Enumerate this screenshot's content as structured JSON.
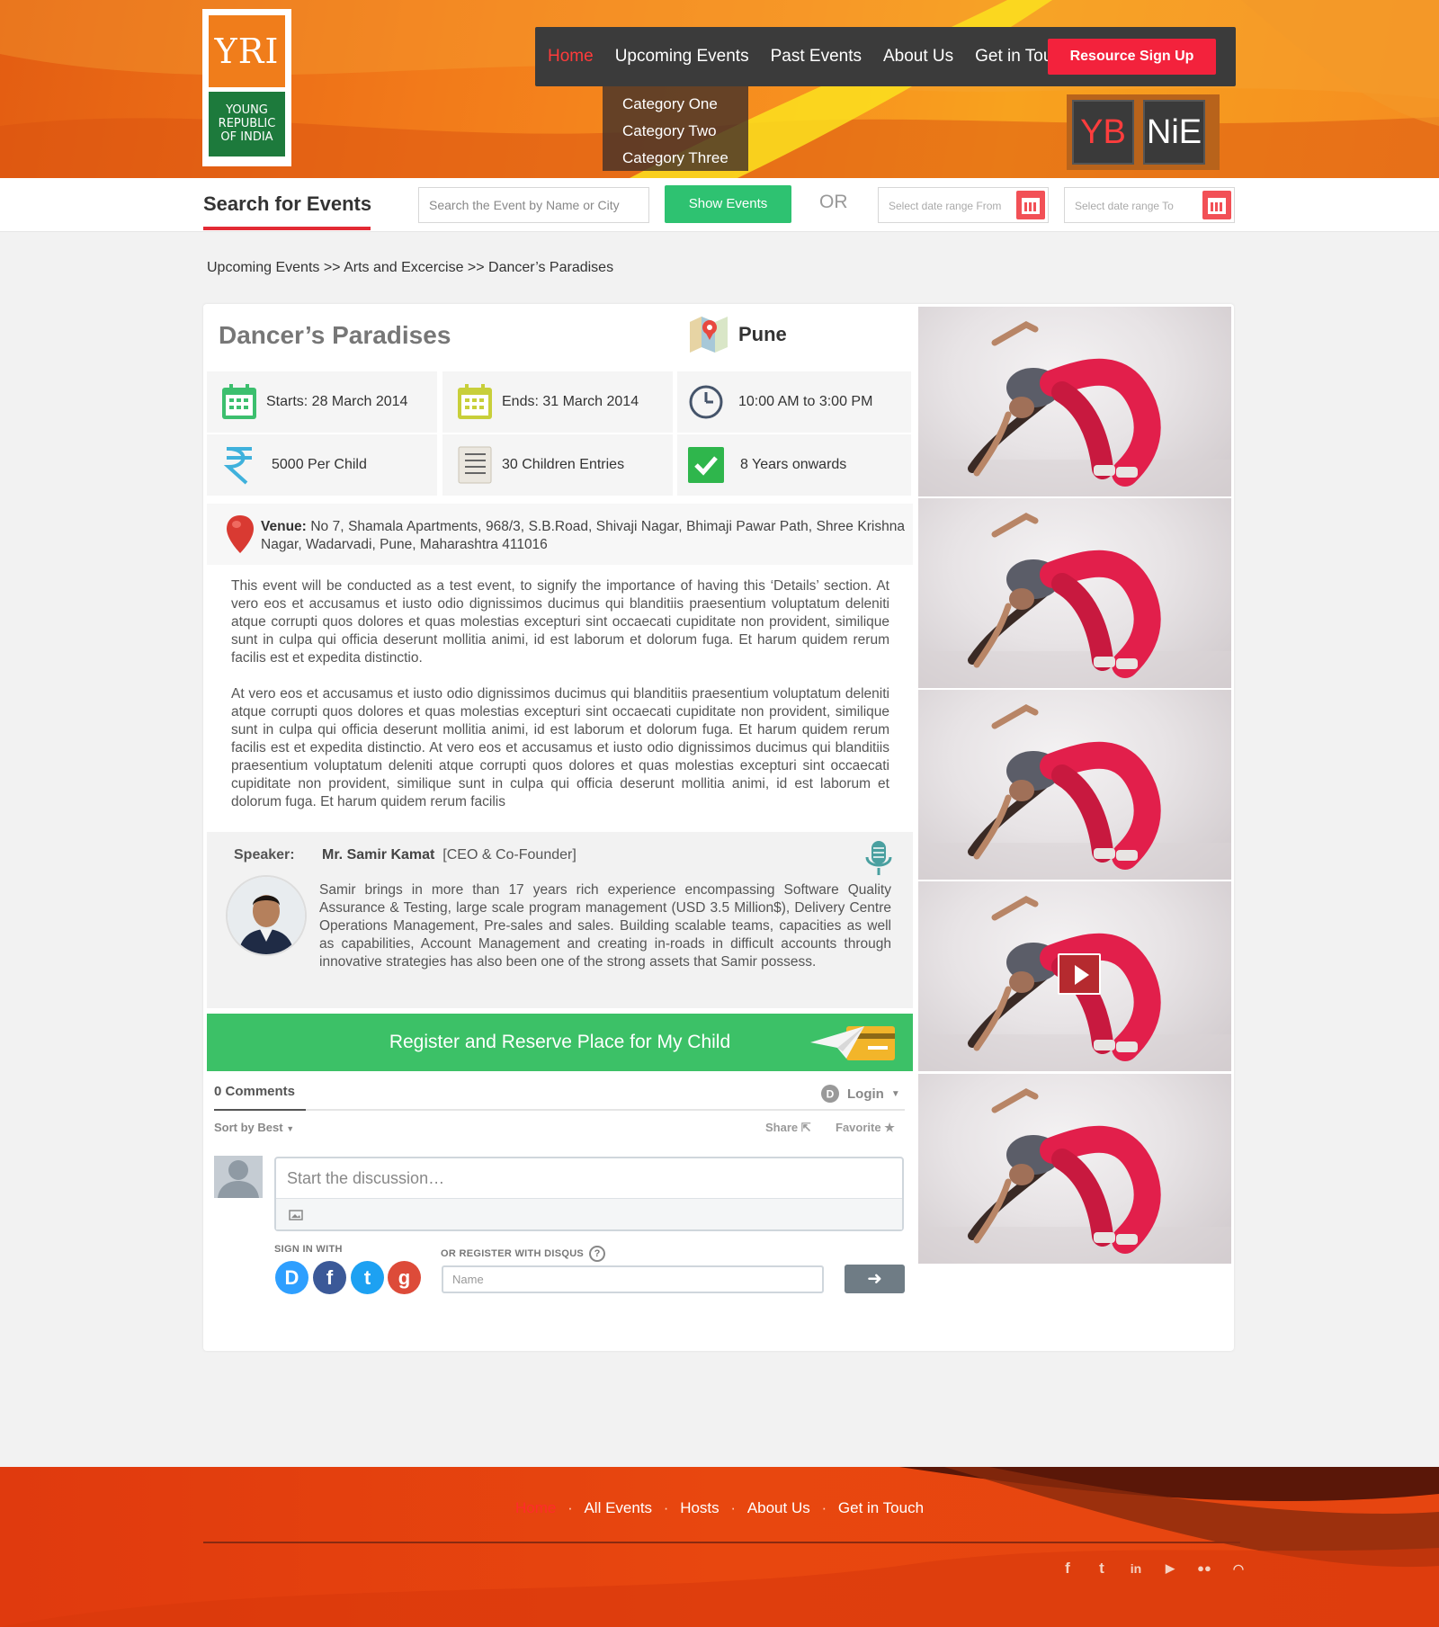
{
  "logo": {
    "mark": "YRI",
    "tagline_lines": [
      "YOUNG",
      "REPUBLIC",
      "OF INDIA"
    ]
  },
  "nav": {
    "items": [
      "Home",
      "Upcoming Events",
      "Past Events",
      "About Us",
      "Get in Touch"
    ],
    "active": "Home",
    "cta": "Resource Sign Up",
    "dropdown": [
      "Category One",
      "Category Two",
      "Category Three"
    ]
  },
  "partners": {
    "left": "YB",
    "right": "NiE"
  },
  "search": {
    "title": "Search for Events",
    "placeholder": "Search the Event by Name or City",
    "button": "Show Events",
    "or": "OR",
    "date_from": "Select date range From",
    "date_to": "Select date range To"
  },
  "breadcrumb": "Upcoming Events >> Arts and Excercise >> Dancer’s Paradises",
  "event": {
    "title": "Dancer’s Paradises",
    "city": "Pune",
    "starts": "Starts: 28 March 2014",
    "ends": "Ends: 31 March 2014",
    "time": "10:00 AM to 3:00 PM",
    "price": "5000 Per Child",
    "entries": "30 Children Entries",
    "age": "8 Years onwards",
    "venue_label": "Venue:",
    "venue": "No 7, Shamala Apartments, 968/3, S.B.Road, Shivaji Nagar, Bhimaji Pawar Path, Shree Krishna Nagar, Wadarvadi, Pune, Maharashtra 411016",
    "description_1": "This event will be conducted as a test event, to signify the importance of having this ‘Details’ section. At vero eos et accusamus et iusto odio dignissimos ducimus qui blanditiis praesentium voluptatum deleniti atque corrupti quos dolores et quas molestias excepturi sint occaecati cupiditate non provident, similique sunt in culpa qui officia deserunt mollitia animi, id est laborum et dolorum fuga. Et harum quidem rerum facilis est et expedita distinctio.",
    "description_2": "At vero eos et accusamus et iusto odio dignissimos ducimus qui blanditiis praesentium voluptatum deleniti atque corrupti quos dolores et quas molestias excepturi sint occaecati cupiditate non provident, similique sunt in culpa qui officia deserunt mollitia animi, id est laborum et dolorum fuga. Et harum quidem rerum facilis est et expedita distinctio. At vero eos et accusamus et iusto odio dignissimos ducimus qui blanditiis praesentium voluptatum deleniti atque corrupti quos dolores et quas molestias excepturi sint occaecati cupiditate non provident, similique sunt in culpa qui officia deserunt mollitia animi, id est laborum et dolorum fuga. Et harum quidem rerum facilis"
  },
  "speaker": {
    "label": "Speaker:",
    "name": "Mr. Samir Kamat",
    "role": "[CEO & Co-Founder]",
    "bio": "Samir brings in more than 17 years rich experience encompassing Software Quality Assurance & Testing, large scale program management (USD 3.5 Million$), Delivery Centre Operations Management, Pre-sales and sales. Building scalable teams, capacities as well as capabilities, Account Management and creating in-roads in difficult accounts through innovative strategies has also been one of the strong assets that Samir possess."
  },
  "register_button": "Register and Reserve Place for My Child",
  "comments": {
    "count": "0 Comments",
    "login": "Login",
    "sort": "Sort by Best",
    "share": "Share",
    "favorite": "Favorite",
    "placeholder": "Start the discussion…",
    "sign_in_with": "SIGN IN WITH",
    "register_with": "OR REGISTER WITH DISQUS",
    "name_placeholder": "Name",
    "social": [
      "D",
      "f",
      "t",
      "g"
    ]
  },
  "footer": {
    "items": [
      "Home",
      "All Events",
      "Hosts",
      "About Us",
      "Get in Touch"
    ],
    "active": "Home",
    "separator": "·",
    "social_icons": [
      "facebook-icon",
      "twitter-icon",
      "linkedin-icon",
      "youtube-icon",
      "flickr-icon",
      "rss-icon"
    ]
  },
  "colors": {
    "accent_red": "#f3223c",
    "green": "#2ec271",
    "register_green": "#3cc167",
    "nav_bg": "#3b3b3b",
    "header_orange": "#f27a1a",
    "footer_orange": "#e8470f"
  }
}
